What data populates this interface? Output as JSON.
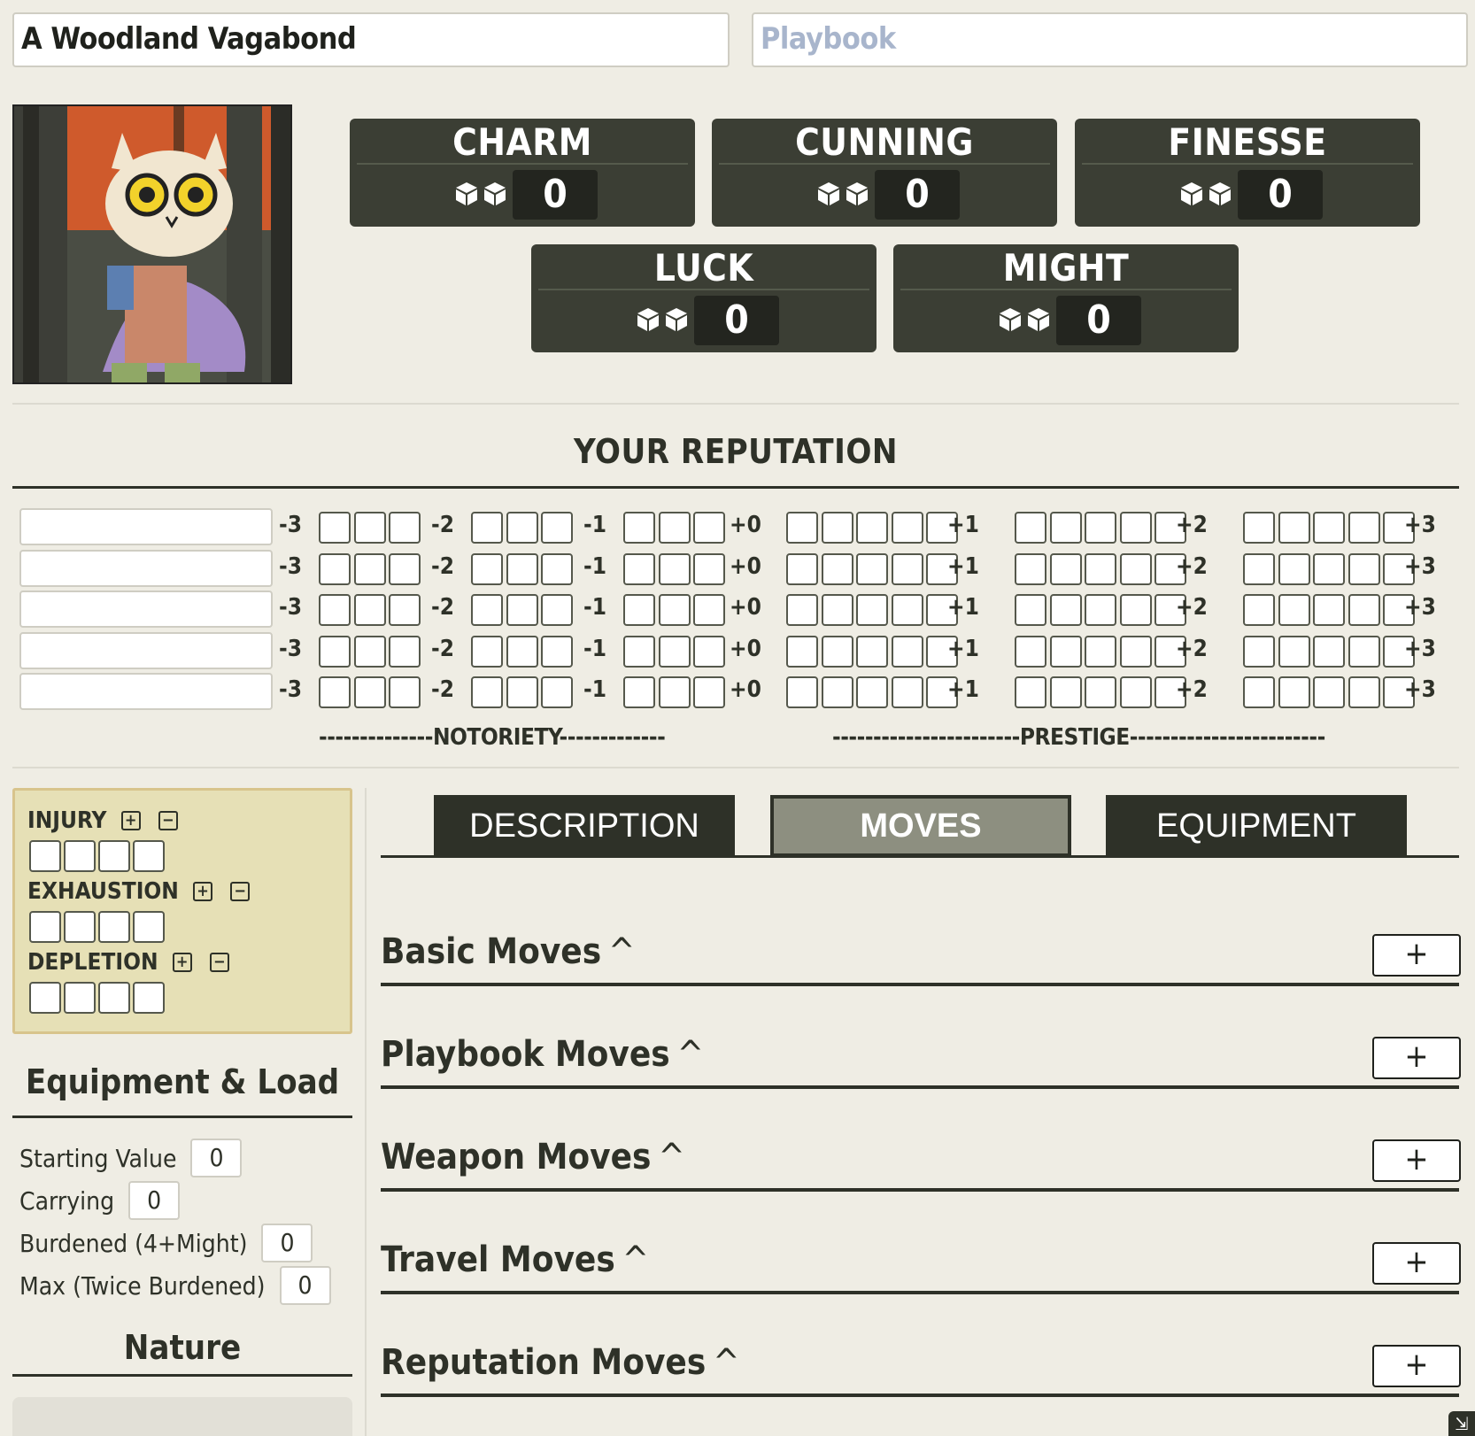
{
  "header": {
    "name_value": "A Woodland Vagabond",
    "playbook_placeholder": "Playbook"
  },
  "portrait": {
    "alt": ""
  },
  "stats": [
    {
      "label": "CHARM",
      "value": "0"
    },
    {
      "label": "CUNNING",
      "value": "0"
    },
    {
      "label": "FINESSE",
      "value": "0"
    },
    {
      "label": "LUCK",
      "value": "0"
    },
    {
      "label": "MIGHT",
      "value": "0"
    }
  ],
  "reputation": {
    "title": "YOUR REPUTATION",
    "levels": [
      "-3",
      "-2",
      "-1",
      "+0",
      "+1",
      "+2",
      "+3"
    ],
    "rows": 5,
    "notoriety_label": "--------------NOTORIETY-------------",
    "prestige_label": "-----------------------PRESTIGE------------------------"
  },
  "harm": {
    "injury": "INJURY",
    "exhaustion": "EXHAUSTION",
    "depletion": "DEPLETION",
    "plus": "+",
    "minus": "−"
  },
  "equipment": {
    "title": "Equipment & Load",
    "starting_value_label": "Starting Value",
    "starting_value": "0",
    "carrying_label": "Carrying",
    "carrying": "0",
    "burdened_label": "Burdened (4+Might)",
    "burdened": "0",
    "max_label": "Max (Twice Burdened)",
    "max": "0"
  },
  "nature": {
    "title": "Nature"
  },
  "tabs": {
    "description": "DESCRIPTION",
    "moves": "MOVES",
    "equipment": "EQUIPMENT"
  },
  "moves": [
    {
      "title": "Basic Moves"
    },
    {
      "title": "Playbook Moves"
    },
    {
      "title": "Weapon Moves"
    },
    {
      "title": "Travel Moves"
    },
    {
      "title": "Reputation Moves"
    }
  ],
  "icons": {
    "chevron_up": "^",
    "add": "+"
  }
}
